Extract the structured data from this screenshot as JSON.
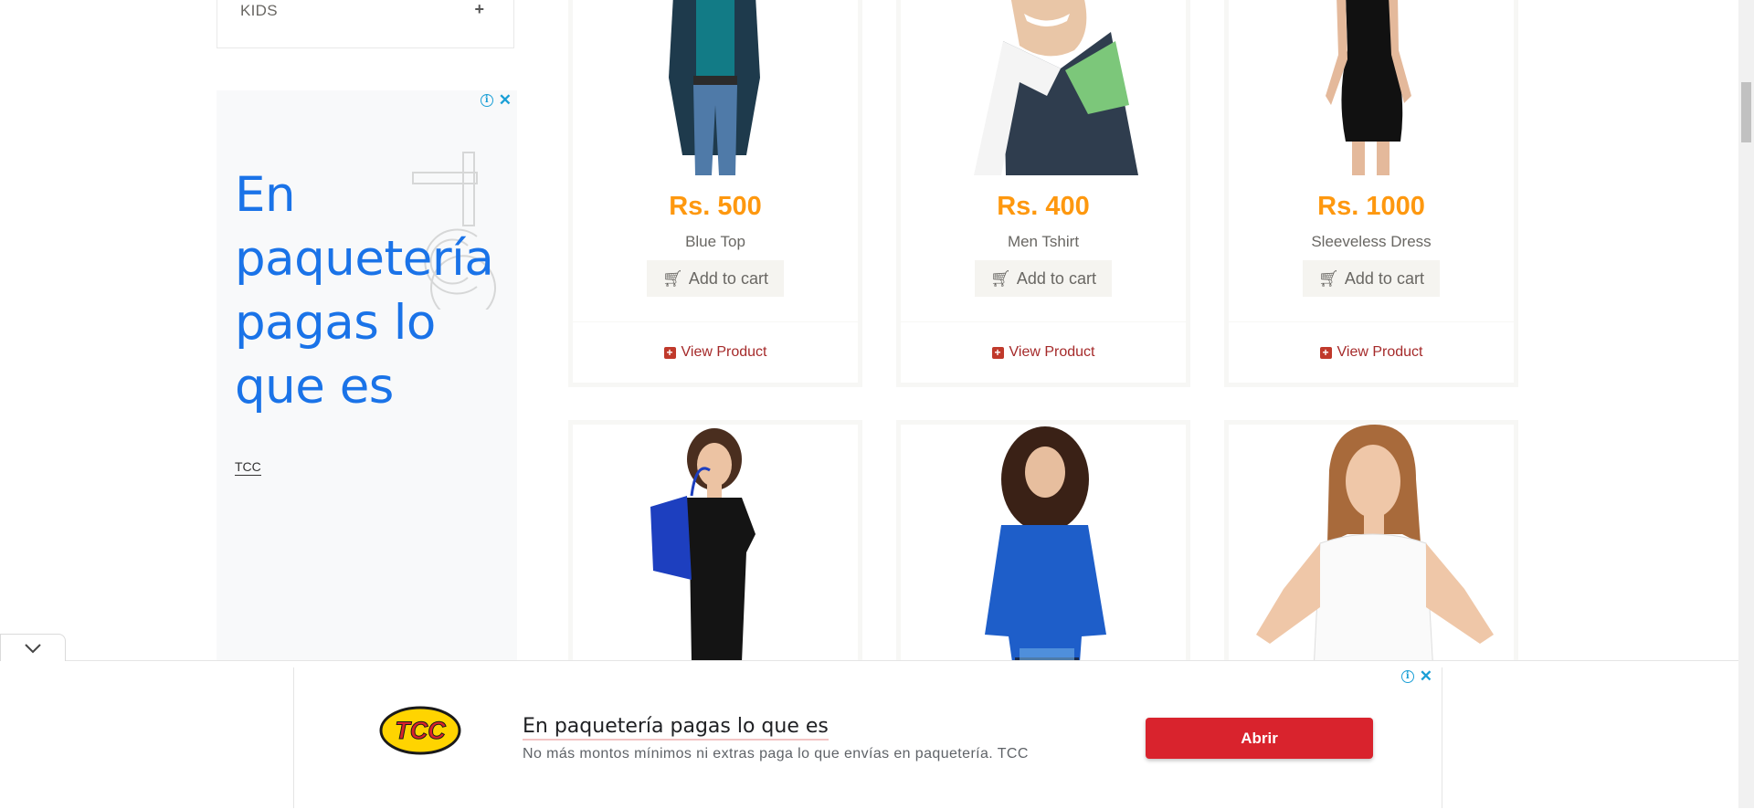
{
  "sidebar": {
    "category": {
      "label": "KIDS",
      "toggle_icon": "plus-icon"
    },
    "ad": {
      "headline": "En paquetería pagas lo que es",
      "brand": "TCC"
    }
  },
  "products_row1": [
    {
      "price": "Rs. 500",
      "name": "Blue Top",
      "cart_label": "Add to cart",
      "view_label": "View Product"
    },
    {
      "price": "Rs. 400",
      "name": "Men Tshirt",
      "cart_label": "Add to cart",
      "view_label": "View Product"
    },
    {
      "price": "Rs. 1000",
      "name": "Sleeveless Dress",
      "cart_label": "Add to cart",
      "view_label": "View Product"
    }
  ],
  "colors": {
    "price": "#fe980f",
    "view_link": "#a52a2a",
    "ad_blue": "#1a73e8",
    "abrir_red": "#d9232d"
  },
  "bottom_ad": {
    "logo_text": "TCC",
    "headline": "En paquetería pagas lo que es",
    "description": "No más montos mínimos ni extras paga lo que envías en paquetería. TCC",
    "button_label": "Abrir"
  }
}
